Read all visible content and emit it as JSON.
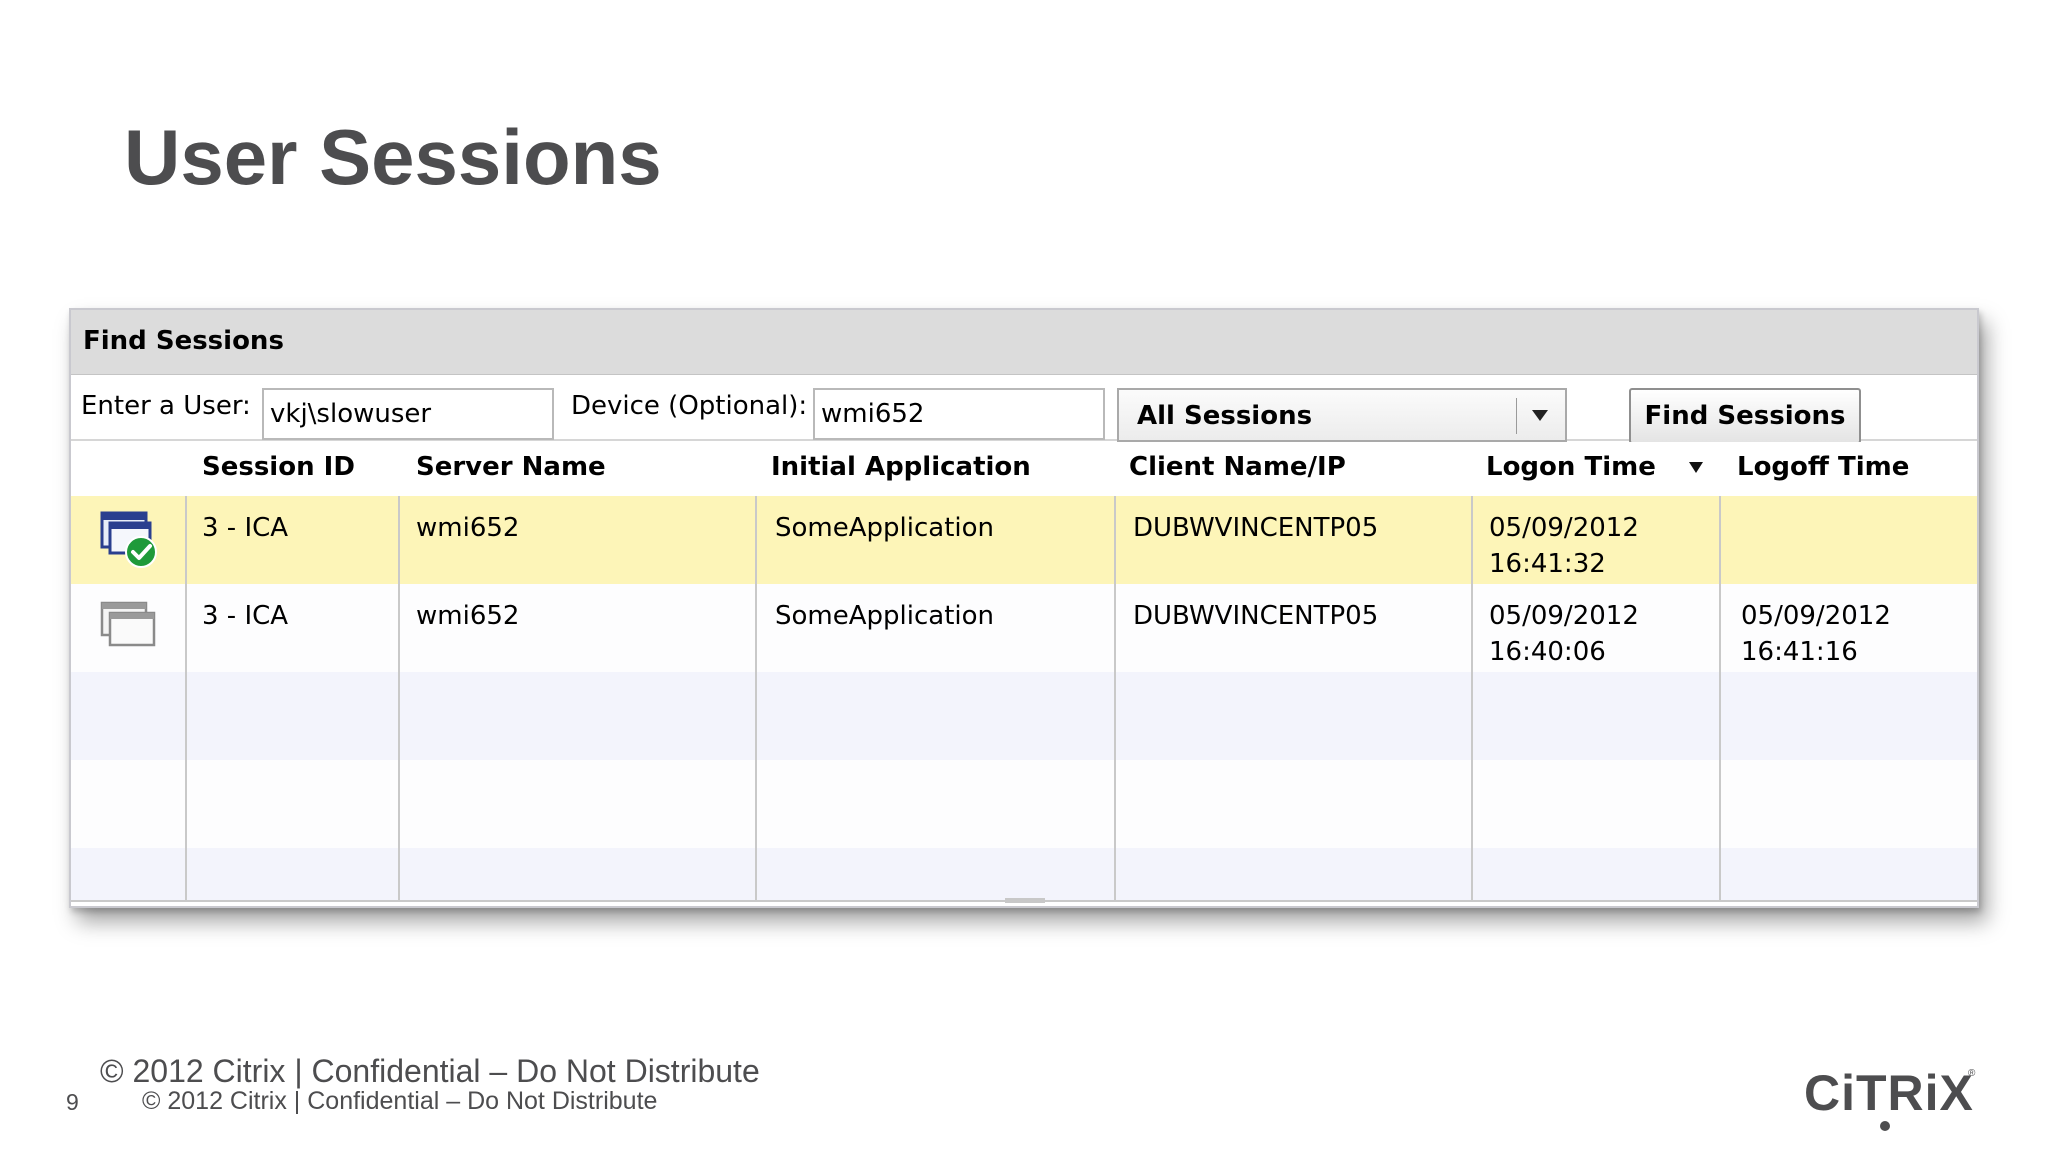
{
  "slide": {
    "title": "User Sessions",
    "copyright_main": "© 2012 Citrix | Confidential – Do Not Distribute",
    "copyright_small": "© 2012 Citrix | Confidential – Do Not Distribute",
    "page_number": "9",
    "logo_text": "CiTRiX"
  },
  "panel": {
    "title": "Find Sessions",
    "user_label": "Enter a User:",
    "user_value": "vkj\\slowuser",
    "device_label": "Device (Optional):",
    "device_value": "wmi652",
    "session_filter": "All Sessions",
    "find_button": "Find Sessions"
  },
  "grid": {
    "columns": [
      "",
      "Session ID",
      "Server Name",
      "Initial Application",
      "Client Name/IP",
      "Logon Time",
      "Logoff Time"
    ],
    "sorted_column": "Logon Time",
    "sort_direction": "descending",
    "rows": [
      {
        "status_icon": "session-active-icon",
        "session_id": "3 - ICA",
        "server": "wmi652",
        "application": "SomeApplication",
        "client": "DUBWVINCENTP05",
        "logon_date": "05/09/2012",
        "logon_time": "16:41:32",
        "logoff_date": "",
        "logoff_time": "",
        "selected": true
      },
      {
        "status_icon": "session-ended-icon",
        "session_id": "3 - ICA",
        "server": "wmi652",
        "application": "SomeApplication",
        "client": "DUBWVINCENTP05",
        "logon_date": "05/09/2012",
        "logon_time": "16:40:06",
        "logoff_date": "05/09/2012",
        "logoff_time": "16:41:16",
        "selected": false
      }
    ]
  },
  "colors": {
    "title_gray": "#4d4d4f",
    "selected_row": "#fdf5b8",
    "alt_row": "#f3f4fc",
    "header_bg": "#dcdcdc",
    "check_green": "#1f9a3a"
  }
}
